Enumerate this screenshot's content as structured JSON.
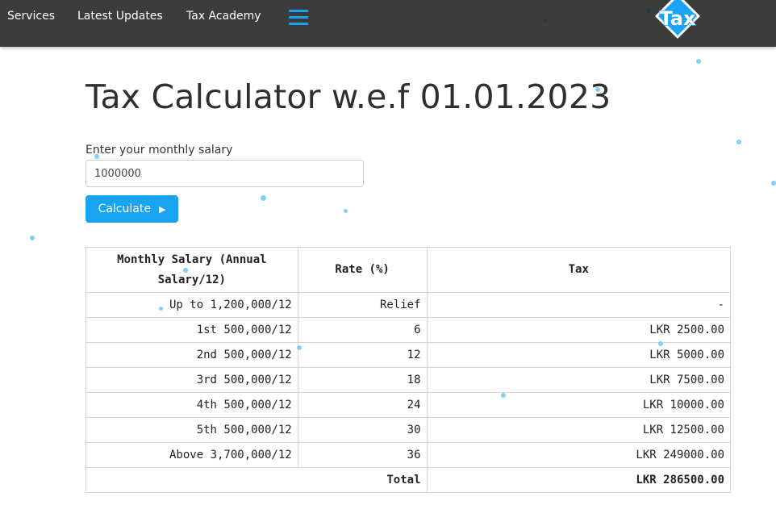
{
  "nav": {
    "items": [
      "Services",
      "Latest Updates",
      "Tax Academy"
    ],
    "menu_icon": "hamburger-menu-icon",
    "logo_text": "Tax"
  },
  "page": {
    "title": "Tax Calculator w.e.f 01.01.2023"
  },
  "form": {
    "salary_label": "Enter your monthly salary",
    "salary_value": "1000000",
    "calculate_label": "Calculate",
    "calculate_icon": "play-icon"
  },
  "table": {
    "headers": [
      "Monthly Salary (Annual Salary/12)",
      "Rate (%)",
      "Tax"
    ],
    "rows": [
      {
        "bracket": "Up to 1,200,000/12",
        "rate": "Relief",
        "tax": "-"
      },
      {
        "bracket": "1st 500,000/12",
        "rate": "6",
        "tax": "LKR 2500.00"
      },
      {
        "bracket": "2nd 500,000/12",
        "rate": "12",
        "tax": "LKR 5000.00"
      },
      {
        "bracket": "3rd 500,000/12",
        "rate": "18",
        "tax": "LKR 7500.00"
      },
      {
        "bracket": "4th 500,000/12",
        "rate": "24",
        "tax": "LKR 10000.00"
      },
      {
        "bracket": "5th 500,000/12",
        "rate": "30",
        "tax": "LKR 12500.00"
      },
      {
        "bracket": "Above 3,700,000/12",
        "rate": "36",
        "tax": "LKR 249000.00"
      }
    ],
    "total_label": "Total",
    "total_value": "LKR 286500.00"
  },
  "colors": {
    "navbar": "#3c3c3c",
    "accent": "#1aa3f0",
    "particle": "#7fd0f7"
  }
}
